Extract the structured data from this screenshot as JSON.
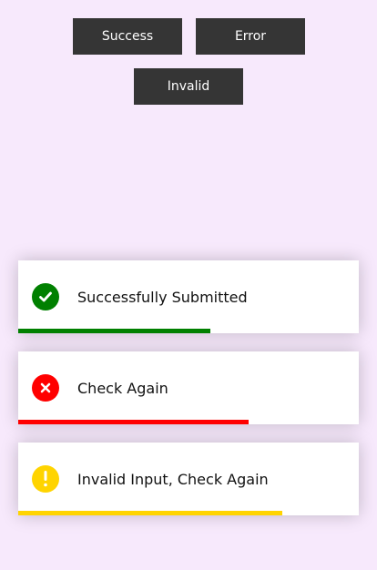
{
  "buttons": {
    "success_label": "Success",
    "error_label": "Error",
    "invalid_label": "Invalid"
  },
  "toasts": [
    {
      "type": "success",
      "message": "Successfully Submitted",
      "icon": "check-circle-icon",
      "color": "#008000",
      "progress": 0.565
    },
    {
      "type": "error",
      "message": "Check Again",
      "icon": "x-circle-icon",
      "color": "#ff0000",
      "progress": 0.677
    },
    {
      "type": "invalid",
      "message": "Invalid Input, Check Again",
      "icon": "exclamation-circle-icon",
      "color": "#ffd400",
      "progress": 0.775
    }
  ],
  "colors": {
    "background": "#f7e9fc",
    "button_bg": "#353535"
  }
}
